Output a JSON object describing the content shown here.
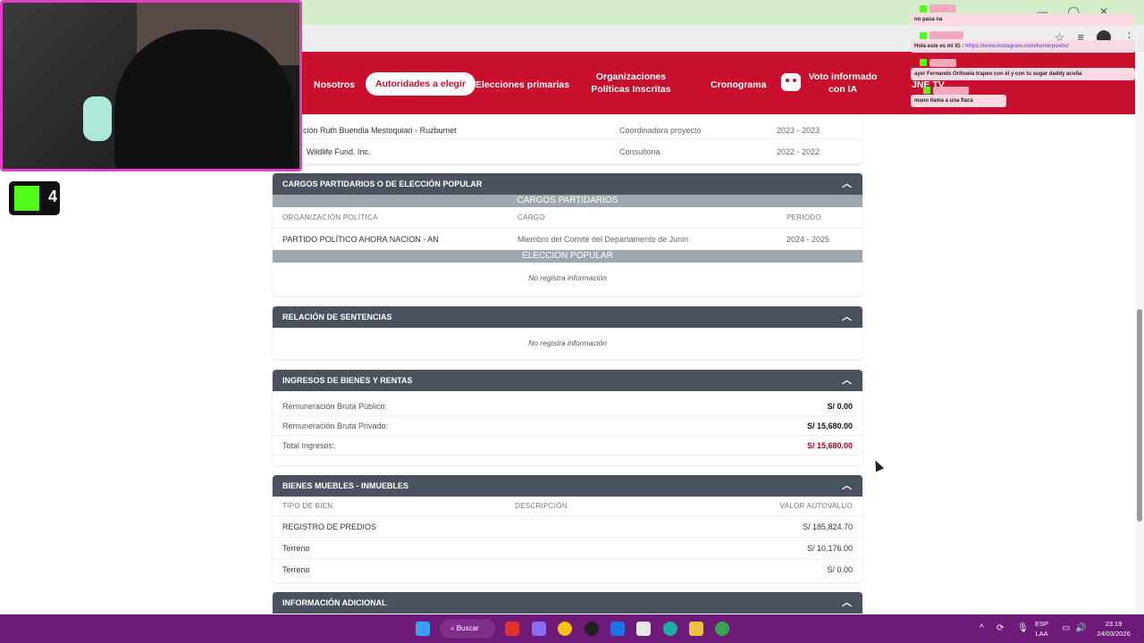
{
  "nav": {
    "items": [
      {
        "label": "Nosotros"
      },
      {
        "label": "Autoridades a elegir"
      },
      {
        "label": "Elecciones primarias"
      },
      {
        "label": "Organizaciones Políticas Inscritas"
      },
      {
        "label": "Cronograma"
      },
      {
        "label": "Voto informado con IA"
      },
      {
        "label": "JNE TV"
      }
    ]
  },
  "experience_rows": [
    {
      "org": "ción Ruth Buendia Mestoquiari - Ruzbumet",
      "role": "Coordinadora proyecto",
      "period": "2023 - 2023"
    },
    {
      "org": "Wildlife Fund. Inc.",
      "role": "Consultoria",
      "period": "2022 - 2022"
    }
  ],
  "cargos": {
    "title": "CARGOS PARTIDARIOS O DE ELECCIÓN POPULAR",
    "partidarios_label": "CARGOS PARTIDARIOS",
    "columns": [
      "ORGANIZACIÓN POLÍTICA",
      "CARGO",
      "PERIODO"
    ],
    "row": {
      "org": "PARTIDO POLÍTICO AHORA NACION - AN",
      "cargo": "Miembro del Comité del Departamento de Junin",
      "period": "2024 - 2025"
    },
    "eleccion_label": "ELECCION POPULAR",
    "empty": "No registra información"
  },
  "sentencias": {
    "title": "RELACIÓN DE SENTENCIAS",
    "empty": "No registra información"
  },
  "ingresos": {
    "title": "INGRESOS DE BIENES Y RENTAS",
    "rows": [
      {
        "label": "Remuneración Bruta Público:",
        "value": "S/ 0.00"
      },
      {
        "label": "Remuneración Bruta Privado:",
        "value": "S/ 15,680.00"
      },
      {
        "label": "Total Ingresos:",
        "value": "S/ 15,680.00"
      }
    ]
  },
  "bienes": {
    "title": "BIENES MUEBLES - INMUEBLES",
    "columns": [
      "TIPO DE BIEN",
      "DESCRIPCIÓN",
      "VALOR AUTOVALUO"
    ],
    "rows": [
      {
        "tipo": "REGISTRO DE PREDIOS",
        "valor": "S/ 185,824.70"
      },
      {
        "tipo": "Terreno",
        "valor": "S/ 10,176.00"
      },
      {
        "tipo": "Terreno",
        "valor": "S/ 0.00"
      }
    ]
  },
  "adicional": {
    "title": "INFORMACIÓN ADICIONAL"
  },
  "overlay": {
    "logo_number": "4",
    "chat": [
      {
        "text": "no pasa na"
      },
      {
        "text": "Hola este es mi IG : ",
        "link": "https://www.instagram.com/karterpoetic/"
      },
      {
        "text": "ayer Fernando Orihuela trapeo con él y con tu sugar daddy acuña"
      },
      {
        "text": "mano llama a una flaca"
      }
    ]
  },
  "taskbar": {
    "search_label": "Buscar",
    "lang_top": "ESP",
    "lang_bottom": "LAA",
    "time": "23:19",
    "date": "24/03/2026"
  },
  "colors": {
    "brand_red": "#c8102e",
    "section_header": "#4a5260",
    "total_red": "#b0001e",
    "taskbar": "#6d1a78",
    "kick_green": "#53fc18"
  }
}
